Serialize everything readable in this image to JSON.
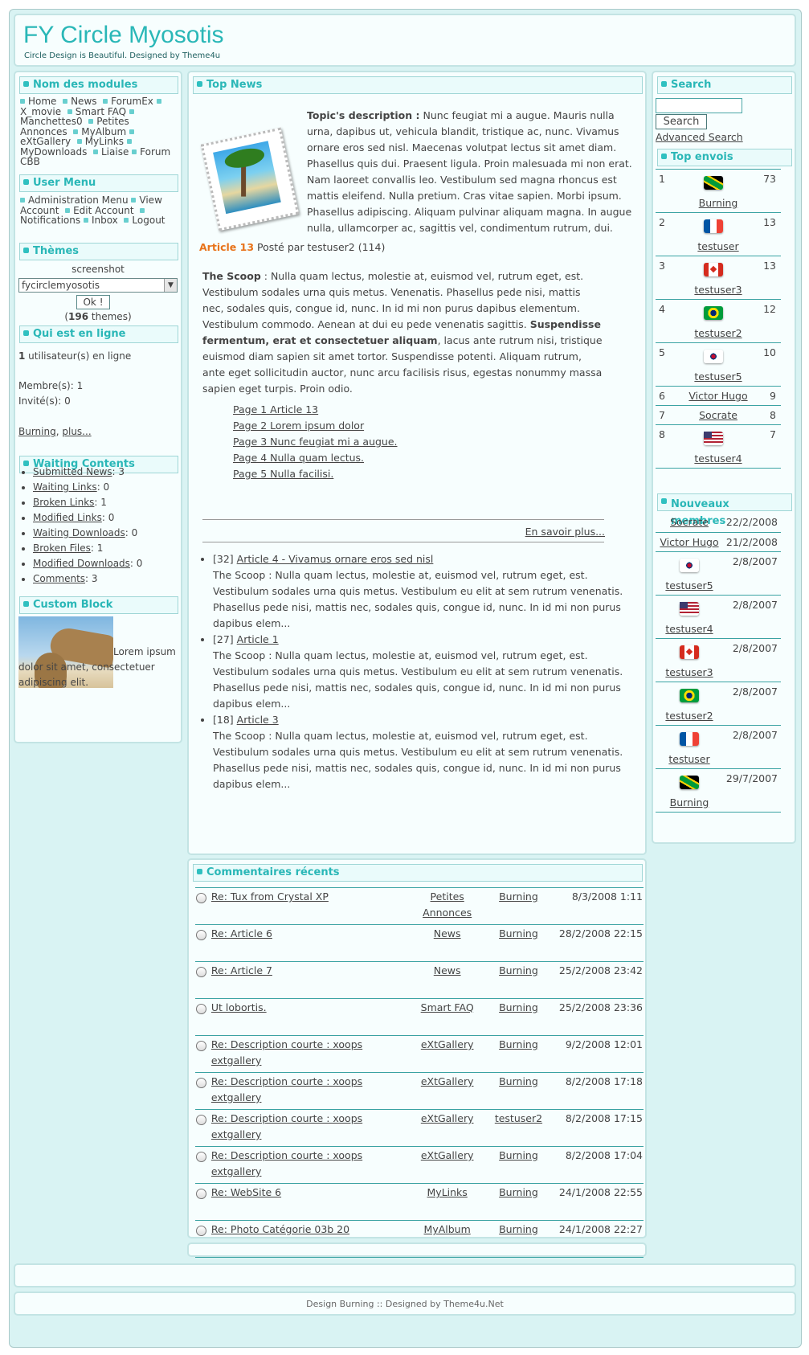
{
  "header": {
    "title": "FY Circle Myosotis",
    "subtitle": "Circle Design is Beautiful. Designed by Theme4u"
  },
  "modules": {
    "title": "Nom des modules",
    "items": [
      "Home",
      "News",
      "ForumEx",
      "X_movie",
      "Smart FAQ",
      "Manchettes0",
      "Petites Annonces",
      "MyAlbum",
      "eXtGallery",
      "MyLinks",
      "MyDownloads",
      "Liaise",
      "Forum CBB"
    ]
  },
  "usermenu": {
    "title": "User Menu",
    "items": [
      "Administration Menu",
      "View Account",
      "Edit Account",
      "Notifications",
      "Inbox",
      "Logout"
    ]
  },
  "themes": {
    "title": "Thèmes",
    "screenshot": "screenshot",
    "selected": "fycirclemyosotis",
    "ok": "Ok !",
    "count_open": "(",
    "count": "196",
    "count_text": " themes)"
  },
  "online": {
    "title": "Qui est en ligne",
    "count": "1",
    "count_text": " utilisateur(s) en ligne",
    "members": "Membre(s): 1",
    "guests": "Invité(s): 0",
    "link1": "Burning",
    "sep": ", ",
    "link2": "plus..."
  },
  "waiting": {
    "title": "Waiting Contents",
    "items": [
      {
        "label": "Submitted News",
        "value": ": 3"
      },
      {
        "label": "Waiting Links",
        "value": ": 0"
      },
      {
        "label": "Broken Links",
        "value": ": 1"
      },
      {
        "label": "Modified Links",
        "value": ": 0"
      },
      {
        "label": "Waiting Downloads",
        "value": ": 0"
      },
      {
        "label": "Broken Files",
        "value": ": 1"
      },
      {
        "label": "Modified Downloads",
        "value": ": 0"
      },
      {
        "label": "Comments",
        "value": ": 3"
      }
    ]
  },
  "custom": {
    "title": "Custom Block",
    "text": "Lorem ipsum dolor sit amet, consectetuer adipiscing elit."
  },
  "topnews": {
    "title": "Top News",
    "desc_label": "Topic's description :",
    "desc_text": " Nunc feugiat mi a augue. Mauris nulla urna, dapibus ut, vehicula blandit, tristique ac, nunc. Vivamus ornare eros sed nisl. Maecenas volutpat lectus sit amet diam. Phasellus quis dui. Praesent ligula. Proin malesuada mi non erat. Nam laoreet convallis leo. Vestibulum sed magna rhoncus est mattis eleifend. Nulla pretium. Cras vitae sapien. Morbi ipsum. Phasellus adipiscing. Aliquam pulvinar aliquam magna. In augue nulla, ullamcorper ac, sagittis vel, condimentum rutrum, dui.",
    "article_label": "Article 13",
    "posted": " Posté par testuser2 (114)",
    "scoop_label": "The Scoop",
    "scoop_text1": " : Nulla quam lectus, molestie at, euismod vel, rutrum eget, est. Vestibulum sodales urna quis metus. Venenatis. Phasellus pede nisi, mattis nec, sodales quis, congue id, nunc. In id mi non purus dapibus elementum. Vestibulum commodo. Aenean at dui eu pede venenatis sagittis. ",
    "scoop_bold": "Suspendisse fermentum, erat et consectetuer aliquam",
    "scoop_text2": ", lacus ante rutrum nisi, tristique euismod diam sapien sit amet tortor. Suspendisse potenti. Aliquam rutrum, ante eget sollicitudin auctor, nunc arcu facilisis risus, egestas nonummy massa sapien eget turpis. Proin odio.",
    "pages": [
      "Page 1 Article 13",
      "Page 2 Lorem ipsum dolor",
      "Page 3 Nunc feugiat mi a augue.",
      "Page 4 Nulla quam lectus.",
      "Page 5 Nulla facilisi."
    ],
    "more": "En savoir plus...",
    "list": [
      {
        "num": "[32] ",
        "link": "Article 4 - Vivamus ornare eros sed nisl",
        "text": "The Scoop : Nulla quam lectus, molestie at, euismod vel, rutrum eget, est. Vestibulum sodales urna quis metus. Vestibulum eu elit at sem rutrum venenatis. Phasellus pede nisi, mattis nec, sodales quis, congue id, nunc. In id mi non purus dapibus elem..."
      },
      {
        "num": "[27] ",
        "link": "Article 1",
        "text": "The Scoop : Nulla quam lectus, molestie at, euismod vel, rutrum eget, est. Vestibulum sodales urna quis metus. Vestibulum eu elit at sem rutrum venenatis. Phasellus pede nisi, mattis nec, sodales quis, congue id, nunc. In id mi non purus dapibus elem..."
      },
      {
        "num": "[18] ",
        "link": "Article 3",
        "text": "The Scoop : Nulla quam lectus, molestie at, euismod vel, rutrum eget, est. Vestibulum sodales urna quis metus. Vestibulum eu elit at sem rutrum venenatis. Phasellus pede nisi, mattis nec, sodales quis, congue id, nunc. In id mi non purus dapibus elem..."
      }
    ]
  },
  "comments": {
    "title": "Commentaires récents",
    "rows": [
      {
        "title": "Re: Tux from Crystal XP",
        "module": "Petites Annonces",
        "user": "Burning",
        "date": "8/3/2008 1:11"
      },
      {
        "title": "Re: Article 6",
        "module": "News",
        "user": "Burning",
        "date": "28/2/2008 22:15"
      },
      {
        "title": "Re: Article 7",
        "module": "News",
        "user": "Burning",
        "date": "25/2/2008 23:42"
      },
      {
        "title": "Ut lobortis.",
        "module": "Smart FAQ",
        "user": "Burning",
        "date": "25/2/2008 23:36"
      },
      {
        "title": "Re: Description courte : xoops extgallery",
        "module": "eXtGallery",
        "user": "Burning",
        "date": "9/2/2008 12:01"
      },
      {
        "title": "Re: Description courte : xoops extgallery",
        "module": "eXtGallery",
        "user": "Burning",
        "date": "8/2/2008 17:18"
      },
      {
        "title": "Re: Description courte : xoops extgallery",
        "module": "eXtGallery",
        "user": "testuser2",
        "date": "8/2/2008 17:15"
      },
      {
        "title": "Re: Description courte : xoops extgallery",
        "module": "eXtGallery",
        "user": "Burning",
        "date": "8/2/2008 17:04"
      },
      {
        "title": "Re: WebSite 6",
        "module": "MyLinks",
        "user": "Burning",
        "date": "24/1/2008 22:55"
      },
      {
        "title": "Re: Photo Catégorie 03b 20",
        "module": "MyAlbum",
        "user": "Burning",
        "date": "24/1/2008 22:27"
      }
    ]
  },
  "search": {
    "title": "Search",
    "button": "Search",
    "advanced": "Advanced Search"
  },
  "topposters": {
    "title": "Top envois",
    "rows": [
      {
        "rank": "1",
        "flag": "jm",
        "name": "Burning",
        "count": "73"
      },
      {
        "rank": "2",
        "flag": "fr",
        "name": "testuser",
        "count": "13"
      },
      {
        "rank": "3",
        "flag": "ca",
        "name": "testuser3",
        "count": "13"
      },
      {
        "rank": "4",
        "flag": "br",
        "name": "testuser2",
        "count": "12"
      },
      {
        "rank": "5",
        "flag": "kr",
        "name": "testuser5",
        "count": "10"
      },
      {
        "rank": "6",
        "flag": "",
        "name": "Victor Hugo",
        "count": "9"
      },
      {
        "rank": "7",
        "flag": "",
        "name": "Socrate",
        "count": "8"
      },
      {
        "rank": "8",
        "flag": "us",
        "name": "testuser4",
        "count": "7"
      }
    ]
  },
  "newmembers": {
    "title": "Nouveaux membres",
    "rows": [
      {
        "flag": "",
        "name": "Socrate",
        "date": "22/2/2008"
      },
      {
        "flag": "",
        "name": "Victor Hugo",
        "date": "21/2/2008"
      },
      {
        "flag": "kr",
        "name": "testuser5",
        "date": "2/8/2007"
      },
      {
        "flag": "us",
        "name": "testuser4",
        "date": "2/8/2007"
      },
      {
        "flag": "ca",
        "name": "testuser3",
        "date": "2/8/2007"
      },
      {
        "flag": "br",
        "name": "testuser2",
        "date": "2/8/2007"
      },
      {
        "flag": "fr",
        "name": "testuser",
        "date": "2/8/2007"
      },
      {
        "flag": "jm",
        "name": "Burning",
        "date": "29/7/2007"
      }
    ]
  },
  "footer": {
    "text": "Design Burning :: Designed by Theme4u.Net"
  },
  "colors": {
    "accent": "#2ab7b7",
    "background": "#d9f3f3",
    "orange": "#e8731a"
  }
}
